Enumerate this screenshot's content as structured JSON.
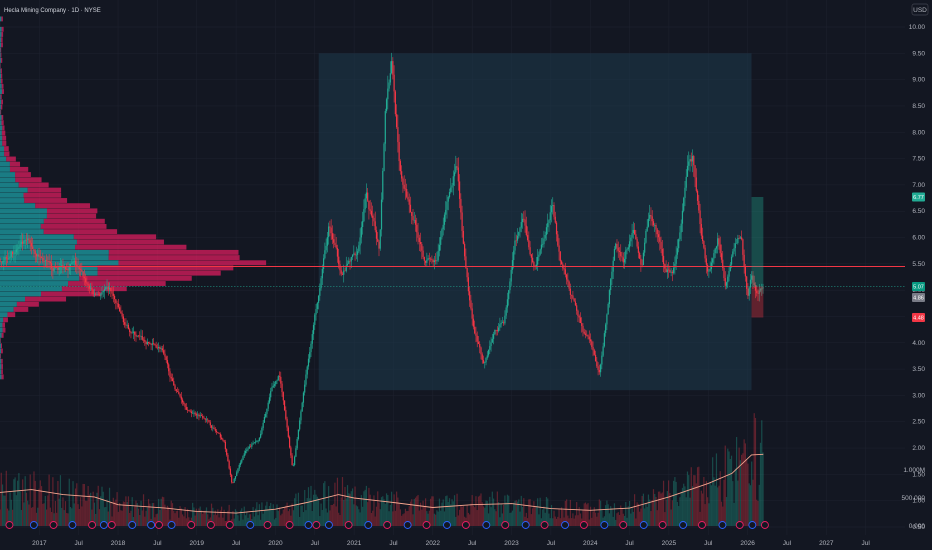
{
  "header": {
    "symbol_title": "Hecla Mining Company · 1D · NYSE",
    "currency": "USD"
  },
  "chart_data": {
    "type": "candlestick",
    "title": "Hecla Mining Company · 1D · NYSE",
    "currency": "USD",
    "price_ticks": [
      0.5,
      1.0,
      1.5,
      2.0,
      2.5,
      3.0,
      3.5,
      4.0,
      4.5,
      5.0,
      5.5,
      6.0,
      6.5,
      7.0,
      7.5,
      8.0,
      8.5,
      9.0,
      9.5,
      10.0
    ],
    "price_tick_labels": [
      "0.50",
      "1.00",
      "1.50",
      "2.00",
      "2.50",
      "3.00",
      "3.50",
      "4.00",
      "4.50",
      "5.00",
      "5.50",
      "6.00",
      "6.50",
      "7.00",
      "7.50",
      "8.00",
      "8.50",
      "9.00",
      "9.50",
      "10.00"
    ],
    "volume_ticks": [
      0,
      500000,
      1000000
    ],
    "volume_tick_labels": [
      "0.000",
      "500.000",
      "1.000M"
    ],
    "time_labels": [
      {
        "t": 2017.0,
        "label": "2017"
      },
      {
        "t": 2017.5,
        "label": "Jul"
      },
      {
        "t": 2018.0,
        "label": "2018"
      },
      {
        "t": 2018.5,
        "label": "Jul"
      },
      {
        "t": 2019.0,
        "label": "2019"
      },
      {
        "t": 2019.5,
        "label": "Jul"
      },
      {
        "t": 2020.0,
        "label": "2020"
      },
      {
        "t": 2020.5,
        "label": "Jul"
      },
      {
        "t": 2021.0,
        "label": "2021"
      },
      {
        "t": 2021.5,
        "label": "Jul"
      },
      {
        "t": 2022.0,
        "label": "2022"
      },
      {
        "t": 2022.5,
        "label": "Jul"
      },
      {
        "t": 2023.0,
        "label": "2023"
      },
      {
        "t": 2023.5,
        "label": "Jul"
      },
      {
        "t": 2024.0,
        "label": "2024"
      },
      {
        "t": 2024.5,
        "label": "Jul"
      },
      {
        "t": 2025.0,
        "label": "2025"
      },
      {
        "t": 2025.5,
        "label": "Jul"
      },
      {
        "t": 2026.0,
        "label": "2026"
      },
      {
        "t": 2026.5,
        "label": "Jul"
      },
      {
        "t": 2027.0,
        "label": "2027"
      },
      {
        "t": 2027.5,
        "label": "Jul"
      }
    ],
    "xlim": [
      2016.5,
      2028.0
    ],
    "ylim": [
      0.5,
      10.0
    ],
    "key_points": [
      {
        "t": 2016.5,
        "p": 5.6
      },
      {
        "t": 2016.85,
        "p": 5.9
      },
      {
        "t": 2017.15,
        "p": 5.4
      },
      {
        "t": 2017.45,
        "p": 5.5
      },
      {
        "t": 2017.7,
        "p": 4.9
      },
      {
        "t": 2017.9,
        "p": 5.0
      },
      {
        "t": 2018.1,
        "p": 4.3
      },
      {
        "t": 2018.35,
        "p": 4.0
      },
      {
        "t": 2018.55,
        "p": 3.9
      },
      {
        "t": 2018.7,
        "p": 3.2
      },
      {
        "t": 2018.9,
        "p": 2.7
      },
      {
        "t": 2019.1,
        "p": 2.6
      },
      {
        "t": 2019.35,
        "p": 2.1
      },
      {
        "t": 2019.45,
        "p": 1.3
      },
      {
        "t": 2019.6,
        "p": 1.9
      },
      {
        "t": 2019.8,
        "p": 2.2
      },
      {
        "t": 2019.95,
        "p": 3.1
      },
      {
        "t": 2020.05,
        "p": 3.4
      },
      {
        "t": 2020.22,
        "p": 1.6
      },
      {
        "t": 2020.38,
        "p": 3.3
      },
      {
        "t": 2020.55,
        "p": 5.0
      },
      {
        "t": 2020.68,
        "p": 6.2
      },
      {
        "t": 2020.85,
        "p": 5.3
      },
      {
        "t": 2021.05,
        "p": 5.8
      },
      {
        "t": 2021.15,
        "p": 6.8
      },
      {
        "t": 2021.32,
        "p": 5.8
      },
      {
        "t": 2021.4,
        "p": 8.6
      },
      {
        "t": 2021.48,
        "p": 9.4
      },
      {
        "t": 2021.58,
        "p": 7.2
      },
      {
        "t": 2021.75,
        "p": 6.4
      },
      {
        "t": 2021.9,
        "p": 5.6
      },
      {
        "t": 2022.05,
        "p": 5.5
      },
      {
        "t": 2022.18,
        "p": 6.7
      },
      {
        "t": 2022.3,
        "p": 7.4
      },
      {
        "t": 2022.4,
        "p": 5.6
      },
      {
        "t": 2022.5,
        "p": 4.4
      },
      {
        "t": 2022.65,
        "p": 3.6
      },
      {
        "t": 2022.78,
        "p": 4.2
      },
      {
        "t": 2022.9,
        "p": 4.4
      },
      {
        "t": 2023.05,
        "p": 5.9
      },
      {
        "t": 2023.15,
        "p": 6.3
      },
      {
        "t": 2023.28,
        "p": 5.4
      },
      {
        "t": 2023.4,
        "p": 5.9
      },
      {
        "t": 2023.52,
        "p": 6.6
      },
      {
        "t": 2023.62,
        "p": 5.6
      },
      {
        "t": 2023.78,
        "p": 4.8
      },
      {
        "t": 2023.92,
        "p": 4.2
      },
      {
        "t": 2024.0,
        "p": 4.0
      },
      {
        "t": 2024.12,
        "p": 3.4
      },
      {
        "t": 2024.22,
        "p": 4.7
      },
      {
        "t": 2024.32,
        "p": 5.9
      },
      {
        "t": 2024.42,
        "p": 5.6
      },
      {
        "t": 2024.55,
        "p": 6.2
      },
      {
        "t": 2024.65,
        "p": 5.4
      },
      {
        "t": 2024.75,
        "p": 6.5
      },
      {
        "t": 2024.85,
        "p": 6.1
      },
      {
        "t": 2024.95,
        "p": 5.4
      },
      {
        "t": 2025.05,
        "p": 5.3
      },
      {
        "t": 2025.15,
        "p": 6.2
      },
      {
        "t": 2025.25,
        "p": 7.4
      },
      {
        "t": 2025.3,
        "p": 7.5
      },
      {
        "t": 2025.4,
        "p": 6.2
      },
      {
        "t": 2025.5,
        "p": 5.3
      },
      {
        "t": 2025.62,
        "p": 6.0
      },
      {
        "t": 2025.72,
        "p": 5.1
      },
      {
        "t": 2025.82,
        "p": 5.9
      },
      {
        "t": 2025.92,
        "p": 6.0
      },
      {
        "t": 2026.0,
        "p": 4.8
      },
      {
        "t": 2026.05,
        "p": 5.3
      },
      {
        "t": 2026.12,
        "p": 4.9
      },
      {
        "t": 2026.2,
        "p": 5.1
      }
    ],
    "volume_ma": [
      {
        "t": 2016.5,
        "v": 600000
      },
      {
        "t": 2016.9,
        "v": 650000
      },
      {
        "t": 2017.3,
        "v": 560000
      },
      {
        "t": 2017.7,
        "v": 520000
      },
      {
        "t": 2018.0,
        "v": 380000
      },
      {
        "t": 2018.6,
        "v": 320000
      },
      {
        "t": 2019.0,
        "v": 260000
      },
      {
        "t": 2019.5,
        "v": 230000
      },
      {
        "t": 2020.0,
        "v": 300000
      },
      {
        "t": 2020.4,
        "v": 420000
      },
      {
        "t": 2020.8,
        "v": 560000
      },
      {
        "t": 2021.0,
        "v": 500000
      },
      {
        "t": 2021.5,
        "v": 420000
      },
      {
        "t": 2022.0,
        "v": 330000
      },
      {
        "t": 2022.5,
        "v": 380000
      },
      {
        "t": 2023.0,
        "v": 400000
      },
      {
        "t": 2023.5,
        "v": 310000
      },
      {
        "t": 2024.0,
        "v": 280000
      },
      {
        "t": 2024.5,
        "v": 320000
      },
      {
        "t": 2025.0,
        "v": 520000
      },
      {
        "t": 2025.5,
        "v": 760000
      },
      {
        "t": 2025.8,
        "v": 940000
      },
      {
        "t": 2026.05,
        "v": 1270000
      },
      {
        "t": 2026.2,
        "v": 1280000
      }
    ],
    "volume_profile": {
      "price_low": 3.3,
      "price_high": 10.2,
      "bins": 70,
      "peak_price": 5.45,
      "spread": 0.55,
      "secondary_price": 6.4,
      "secondary_spread": 0.8
    },
    "point_of_control": 5.45,
    "last_price": 5.07,
    "price_badges": [
      {
        "price": 6.77,
        "label": "6.77",
        "color": "#22ab94"
      },
      {
        "price": 5.07,
        "label": "5.07",
        "color": "#089981"
      },
      {
        "price": 4.86,
        "label": "4.86",
        "color": "#787b86"
      },
      {
        "price": 4.48,
        "label": "4.48",
        "color": "#f23645"
      }
    ],
    "range_box": {
      "t0": 2020.55,
      "t1": 2026.05,
      "p0": 3.1,
      "p1": 9.5
    },
    "position_tool": {
      "t0": 2026.05,
      "t1": 2026.2,
      "entry": 5.07,
      "target": 6.77,
      "stop": 4.48
    },
    "events": [
      {
        "t": 2016.62,
        "kind": "D"
      },
      {
        "t": 2016.93,
        "kind": "E"
      },
      {
        "t": 2017.18,
        "kind": "D"
      },
      {
        "t": 2017.42,
        "kind": "E"
      },
      {
        "t": 2017.67,
        "kind": "D"
      },
      {
        "t": 2017.82,
        "kind": "E"
      },
      {
        "t": 2017.92,
        "kind": "D"
      },
      {
        "t": 2018.18,
        "kind": "E"
      },
      {
        "t": 2018.42,
        "kind": "E"
      },
      {
        "t": 2018.52,
        "kind": "D"
      },
      {
        "t": 2018.68,
        "kind": "E"
      },
      {
        "t": 2018.93,
        "kind": "D"
      },
      {
        "t": 2019.18,
        "kind": "D"
      },
      {
        "t": 2019.42,
        "kind": "D"
      },
      {
        "t": 2019.68,
        "kind": "E"
      },
      {
        "t": 2019.9,
        "kind": "D"
      },
      {
        "t": 2020.18,
        "kind": "D"
      },
      {
        "t": 2020.42,
        "kind": "E"
      },
      {
        "t": 2020.52,
        "kind": "D"
      },
      {
        "t": 2020.68,
        "kind": "E"
      },
      {
        "t": 2020.93,
        "kind": "D"
      },
      {
        "t": 2021.18,
        "kind": "E"
      },
      {
        "t": 2021.42,
        "kind": "D"
      },
      {
        "t": 2021.68,
        "kind": "E"
      },
      {
        "t": 2021.92,
        "kind": "D"
      },
      {
        "t": 2022.18,
        "kind": "E"
      },
      {
        "t": 2022.42,
        "kind": "D"
      },
      {
        "t": 2022.68,
        "kind": "E"
      },
      {
        "t": 2022.92,
        "kind": "D"
      },
      {
        "t": 2023.18,
        "kind": "E"
      },
      {
        "t": 2023.42,
        "kind": "D"
      },
      {
        "t": 2023.68,
        "kind": "E"
      },
      {
        "t": 2023.92,
        "kind": "D"
      },
      {
        "t": 2024.18,
        "kind": "E"
      },
      {
        "t": 2024.42,
        "kind": "D"
      },
      {
        "t": 2024.68,
        "kind": "E"
      },
      {
        "t": 2024.92,
        "kind": "D"
      },
      {
        "t": 2025.18,
        "kind": "E"
      },
      {
        "t": 2025.42,
        "kind": "D"
      },
      {
        "t": 2025.68,
        "kind": "E"
      },
      {
        "t": 2025.9,
        "kind": "D"
      },
      {
        "t": 2026.06,
        "kind": "E"
      },
      {
        "t": 2026.22,
        "kind": "D"
      }
    ]
  },
  "colors": {
    "background": "#131722",
    "grid": "#1f2330",
    "axis_text": "#b2b5be",
    "up": "#22ab94",
    "down": "#f23645",
    "profile_up": "#1e9fa6",
    "profile_down": "#e91e63",
    "poc_line": "#f23645",
    "last_price_line": "#22ab94",
    "range_box": "#1e3a4c",
    "volume_ma": "#f7a68f",
    "event_earnings": "#2962ff",
    "event_dividend": "#e91e63"
  }
}
